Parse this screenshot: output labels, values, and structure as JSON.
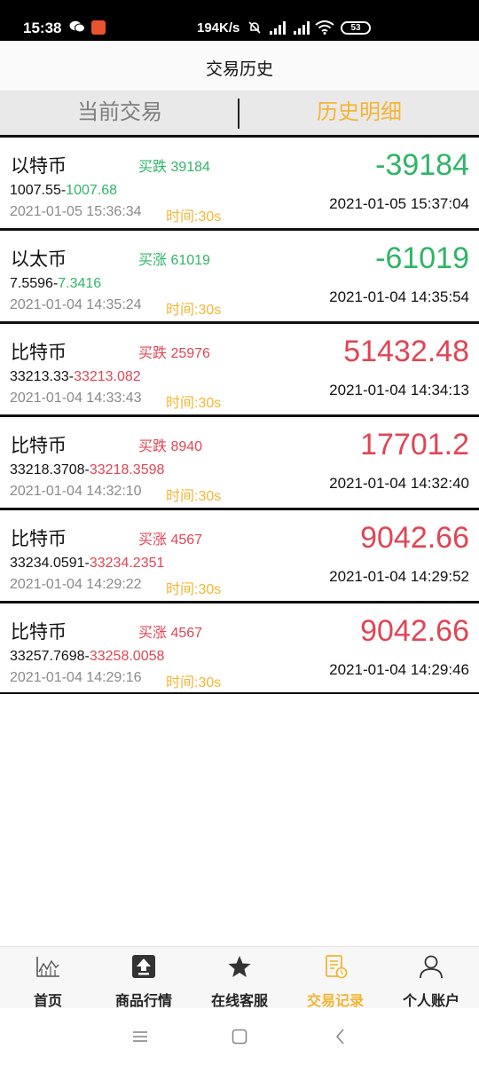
{
  "status_bar": {
    "time": "15:38",
    "speed": "194K/s",
    "battery": "53",
    "icons": [
      "wechat-icon",
      "app-badge-icon",
      "mute-bell-icon",
      "signal-hd-icon",
      "signal-hd-icon",
      "wifi-icon",
      "battery-icon"
    ]
  },
  "header": {
    "title": "交易历史"
  },
  "tabs": [
    {
      "label": "当前交易",
      "active": false
    },
    {
      "label": "历史明细",
      "active": true
    }
  ],
  "trades": [
    {
      "name": "以特币",
      "direction": "买跌 39184",
      "direction_color": "green",
      "open_price": "1007.55",
      "close_price": "1007.68",
      "price_color": "green",
      "open_time": "2021-01-05 15:36:34",
      "duration": "时间:30s",
      "pnl": "-39184",
      "pnl_color": "green",
      "close_time": "2021-01-05 15:37:04"
    },
    {
      "name": "以太币",
      "direction": "买涨 61019",
      "direction_color": "green",
      "open_price": "7.5596",
      "close_price": "7.3416",
      "price_color": "green",
      "open_time": "2021-01-04 14:35:24",
      "duration": "时间:30s",
      "pnl": "-61019",
      "pnl_color": "green",
      "close_time": "2021-01-04 14:35:54"
    },
    {
      "name": "比特币",
      "direction": "买跌 25976",
      "direction_color": "red",
      "open_price": "33213.33",
      "close_price": "33213.082",
      "price_color": "red",
      "open_time": "2021-01-04 14:33:43",
      "duration": "时间:30s",
      "pnl": "51432.48",
      "pnl_color": "red",
      "close_time": "2021-01-04 14:34:13"
    },
    {
      "name": "比特币",
      "direction": "买跌 8940",
      "direction_color": "red",
      "open_price": "33218.3708",
      "close_price": "33218.3598",
      "price_color": "red",
      "open_time": "2021-01-04 14:32:10",
      "duration": "时间:30s",
      "pnl": "17701.2",
      "pnl_color": "red",
      "close_time": "2021-01-04 14:32:40"
    },
    {
      "name": "比特币",
      "direction": "买涨 4567",
      "direction_color": "red",
      "open_price": "33234.0591",
      "close_price": "33234.2351",
      "price_color": "red",
      "open_time": "2021-01-04 14:29:22",
      "duration": "时间:30s",
      "pnl": "9042.66",
      "pnl_color": "red",
      "close_time": "2021-01-04 14:29:52"
    },
    {
      "name": "比特币",
      "direction": "买涨 4567",
      "direction_color": "red",
      "open_price": "33257.7698",
      "close_price": "33258.0058",
      "price_color": "red",
      "open_time": "2021-01-04 14:29:16",
      "duration": "时间:30s",
      "pnl": "9042.66",
      "pnl_color": "red",
      "close_time": "2021-01-04 14:29:46"
    }
  ],
  "bottom_nav": [
    {
      "label": "首页",
      "icon": "chart-icon",
      "active": false
    },
    {
      "label": "商品行情",
      "icon": "upload-arrow-icon",
      "active": false
    },
    {
      "label": "在线客服",
      "icon": "star-icon",
      "active": false
    },
    {
      "label": "交易记录",
      "icon": "document-clock-icon",
      "active": true
    },
    {
      "label": "个人账户",
      "icon": "person-icon",
      "active": false
    }
  ],
  "system_nav": [
    "menu-icon",
    "home-square-icon",
    "back-chevron-icon"
  ],
  "colors": {
    "accent": "#f2b535",
    "up": "#e04555",
    "down": "#2fb566"
  }
}
